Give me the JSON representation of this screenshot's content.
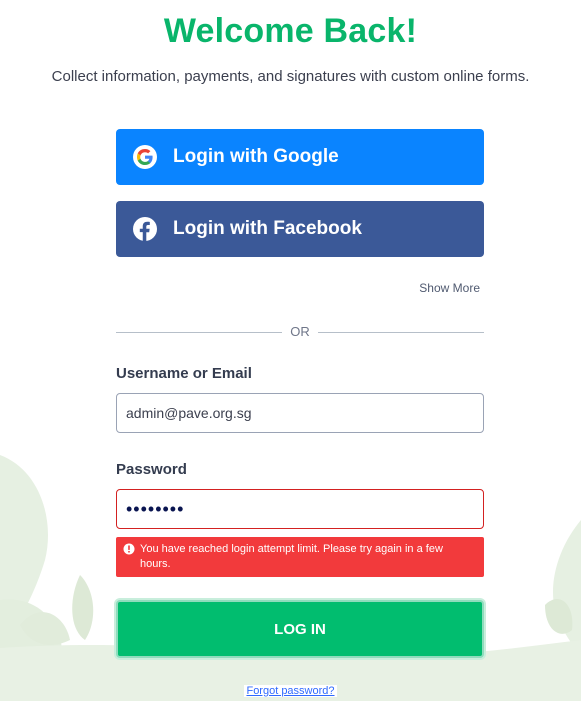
{
  "header": {
    "title": "Welcome Back!",
    "subtitle": "Collect information, payments, and signatures with custom online forms."
  },
  "social": {
    "google_label": "Login with Google",
    "google_icon": "google-g-icon",
    "facebook_label": "Login with Facebook",
    "facebook_icon": "facebook-f-icon",
    "show_more": "Show More"
  },
  "divider": {
    "text": "OR"
  },
  "form": {
    "username_label": "Username or Email",
    "username_value": "admin@pave.org.sg",
    "password_label": "Password",
    "password_masked": "••••••••",
    "error_icon": "alert-circle-icon",
    "error_message": "You have reached login attempt limit. Please try again in a few hours.",
    "login_label": "LOG IN",
    "forgot_label": "Forgot password?"
  },
  "colors": {
    "brand_green": "#09b56b",
    "google_blue": "#0a84ff",
    "facebook_blue": "#3b5998",
    "error_red": "#f23a3c",
    "login_green": "#01bd6f"
  }
}
